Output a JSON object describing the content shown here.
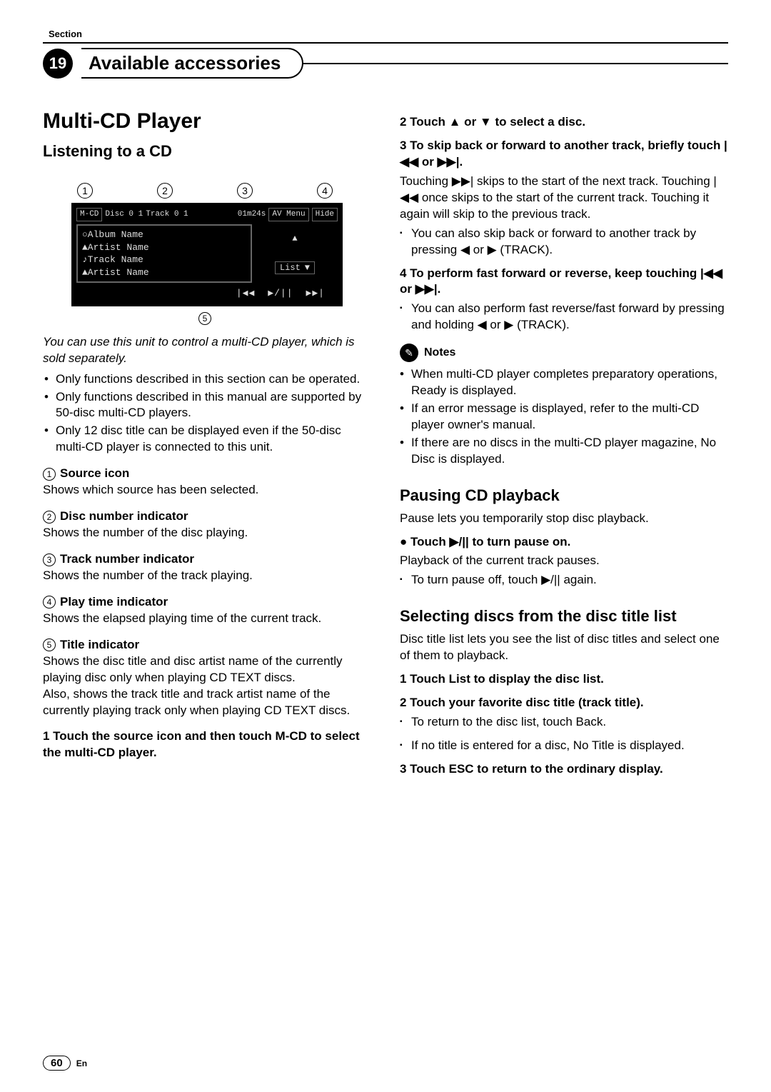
{
  "header": {
    "section_label": "Section",
    "chapter_number": "19",
    "chapter_title": "Available accessories"
  },
  "left": {
    "h1": "Multi-CD Player",
    "h2": "Listening to a CD",
    "screen": {
      "source": "M-CD",
      "disc_label": "Disc 0 1",
      "track_label": "Track 0 1",
      "time": "01m24s",
      "menu": "AV Menu",
      "hide": "Hide",
      "lines": [
        "○Album Name",
        "▲Artist Name",
        "♪Track Name",
        "▲Artist Name"
      ],
      "list": "List",
      "controls": [
        "|◀◀",
        "▶/||",
        "▶▶|"
      ]
    },
    "intro": "You can use this unit to control a multi-CD player, which is sold separately.",
    "bullets": [
      "Only functions described in this section can be operated.",
      "Only functions described in this manual are supported by 50-disc multi-CD players.",
      "Only 12 disc title can be displayed even if the 50-disc multi-CD player is connected to this unit."
    ],
    "defs": [
      {
        "n": "1",
        "label": "Source icon",
        "body": "Shows which source has been selected."
      },
      {
        "n": "2",
        "label": "Disc number indicator",
        "body": "Shows the number of the disc playing."
      },
      {
        "n": "3",
        "label": "Track number indicator",
        "body": "Shows the number of the track playing."
      },
      {
        "n": "4",
        "label": "Play time indicator",
        "body": "Shows the elapsed playing time of the current track."
      },
      {
        "n": "5",
        "label": "Title indicator",
        "body": "Shows the disc title and disc artist name of the currently playing disc only when playing CD TEXT discs.\nAlso, shows the track title and track artist name of the currently playing track only when playing CD TEXT discs."
      }
    ],
    "step1": "1   Touch the source icon and then touch M-CD to select the multi-CD player."
  },
  "right": {
    "step2": "2   Touch ▲ or ▼ to select a disc.",
    "step3_lead": "3   To skip back or forward to another track, briefly touch |◀◀ or ▶▶|.",
    "step3_body": "Touching ▶▶| skips to the start of the next track. Touching |◀◀ once skips to the start of the current track. Touching it again will skip to the previous track.",
    "step3_sub": "You can also skip back or forward to another track by pressing ◀ or ▶ (TRACK).",
    "step4_lead": "4   To perform fast forward or reverse, keep touching |◀◀ or ▶▶|.",
    "step4_sub": "You can also perform fast reverse/fast forward by pressing and holding ◀ or ▶ (TRACK).",
    "notes_title": "Notes",
    "notes": [
      "When multi-CD player completes preparatory operations, Ready is displayed.",
      "If an error message is displayed, refer to the multi-CD player owner's manual.",
      "If there are no discs in the multi-CD player magazine, No Disc is displayed."
    ],
    "pause_h": "Pausing CD playback",
    "pause_intro": "Pause lets you temporarily stop disc playback.",
    "pause_step": "●   Touch ▶/|| to turn pause on.",
    "pause_body": "Playback of the current track pauses.",
    "pause_sub": "To turn pause off, touch ▶/|| again.",
    "sel_h": "Selecting discs from the disc title list",
    "sel_intro": "Disc title list lets you see the list of disc titles and select one of them to playback.",
    "sel_step1": "1   Touch List to display the disc list.",
    "sel_step2": "2   Touch your favorite disc title (track title).",
    "sel_sub1": "To return to the disc list, touch Back.",
    "sel_sub2": "If no title is entered for a disc, No Title is displayed.",
    "sel_step3": "3   Touch ESC to return to the ordinary display."
  },
  "footer": {
    "page": "60",
    "lang": "En"
  }
}
